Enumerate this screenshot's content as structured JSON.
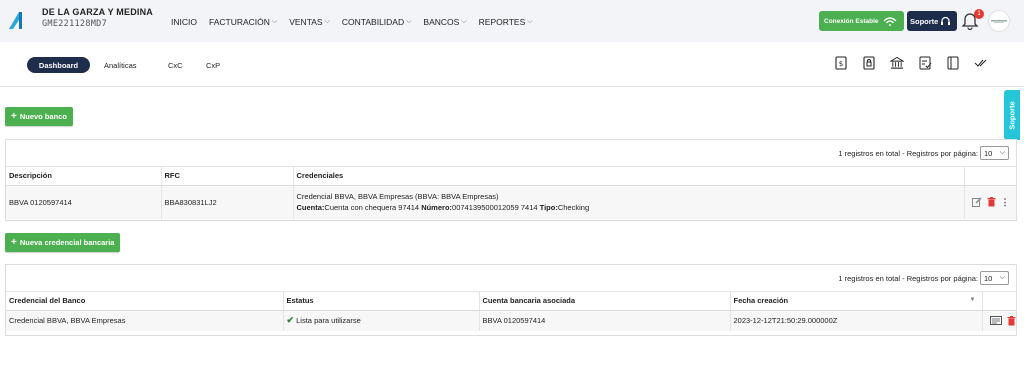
{
  "header": {
    "company": "DE LA GARZA Y MEDINA",
    "rfc": "GME221128MD7",
    "nav": [
      {
        "label": "INICIO",
        "dropdown": false
      },
      {
        "label": "FACTURACIÓN",
        "dropdown": true
      },
      {
        "label": "VENTAS",
        "dropdown": true
      },
      {
        "label": "CONTABILIDAD",
        "dropdown": true
      },
      {
        "label": "BANCOS",
        "dropdown": true
      },
      {
        "label": "REPORTES",
        "dropdown": true
      }
    ],
    "connection_label": "Conexión Estable",
    "support_label": "Soporte",
    "notifications_count": "1",
    "colors": {
      "green": "#4caf50",
      "navy": "#1f2d4d",
      "cyan": "#26c6da",
      "red": "#e53935"
    }
  },
  "subnav": {
    "tabs": [
      "Dashboard",
      "Analíticas",
      "CxC",
      "CxP"
    ],
    "active_tab": "Dashboard",
    "icons": [
      "invoice-dollar-icon",
      "lock-document-icon",
      "bank-icon",
      "checklist-icon",
      "notebook-icon",
      "double-check-icon"
    ]
  },
  "side_support_label": "Soporte",
  "banks": {
    "new_button": "Nuevo banco",
    "total_text": "1 registros en total - Registros por página:",
    "per_page": "10",
    "columns": [
      "Descripción",
      "RFC",
      "Credenciales"
    ],
    "rows": [
      {
        "descripcion": "BBVA 0120597414",
        "rfc": "BBA830831LJ2",
        "credencial": "Credencial BBVA, BBVA Empresas (BBVA: BBVA Empresas)",
        "cuenta_label": "Cuenta:",
        "cuenta": "Cuenta con chequera 97414",
        "numero_label": "Número:",
        "numero": "0074139500012059 7414",
        "tipo_label": "Tipo:",
        "tipo": "Checking"
      }
    ]
  },
  "credentials": {
    "new_button": "Nueva credencial bancaria",
    "total_text": "1 registros en total - Registros por página:",
    "per_page": "10",
    "columns": [
      "Credencial del Banco",
      "Estatus",
      "Cuenta bancaria asociada",
      "Fecha creación"
    ],
    "rows": [
      {
        "credencial": "Credencial BBVA, BBVA Empresas",
        "estatus": "Lista para utilizarse",
        "cuenta": "BBVA 0120597414",
        "fecha": "2023-12-12T21:50:29.000000Z"
      }
    ]
  }
}
